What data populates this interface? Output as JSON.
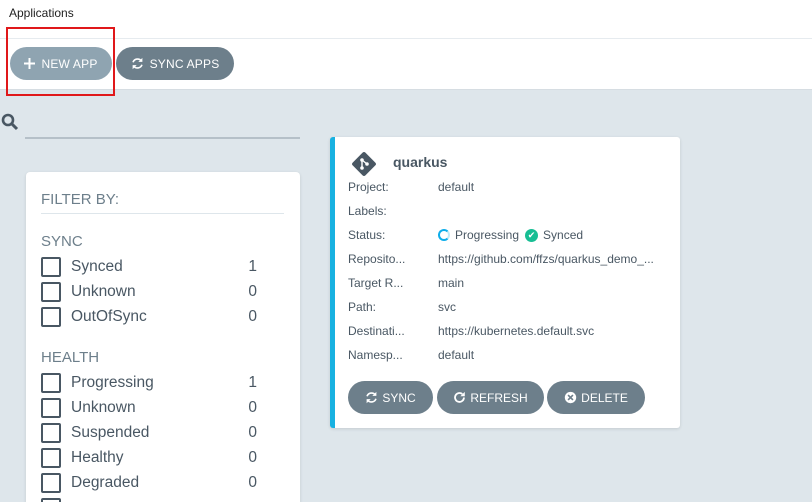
{
  "header": {
    "title": "Applications"
  },
  "toolbar": {
    "new_app_label": "NEW APP",
    "sync_apps_label": "SYNC APPS"
  },
  "filter": {
    "title": "FILTER BY:",
    "sync": {
      "title": "SYNC",
      "items": [
        {
          "label": "Synced",
          "count": "1"
        },
        {
          "label": "Unknown",
          "count": "0"
        },
        {
          "label": "OutOfSync",
          "count": "0"
        }
      ]
    },
    "health": {
      "title": "HEALTH",
      "items": [
        {
          "label": "Progressing",
          "count": "1"
        },
        {
          "label": "Unknown",
          "count": "0"
        },
        {
          "label": "Suspended",
          "count": "0"
        },
        {
          "label": "Healthy",
          "count": "0"
        },
        {
          "label": "Degraded",
          "count": "0"
        }
      ]
    }
  },
  "app": {
    "name": "quarkus",
    "project_key": "Project:",
    "project_val": "default",
    "labels_key": "Labels:",
    "labels_val": "",
    "status_key": "Status:",
    "health_status": "Progressing",
    "sync_status": "Synced",
    "repo_key": "Reposito...",
    "repo_val": "https://github.com/ffzs/quarkus_demo_...",
    "target_key": "Target R...",
    "target_val": "main",
    "path_key": "Path:",
    "path_val": "svc",
    "dest_key": "Destinati...",
    "dest_val": "https://kubernetes.default.svc",
    "ns_key": "Namesp...",
    "ns_val": "default",
    "sync_label": "SYNC",
    "refresh_label": "REFRESH",
    "delete_label": "DELETE"
  },
  "colors": {
    "accent": "#18b1e1",
    "button": "#6d7f8b",
    "button_light": "#8fa4b1",
    "synced": "#18be94",
    "highlight": "#e0181a"
  }
}
